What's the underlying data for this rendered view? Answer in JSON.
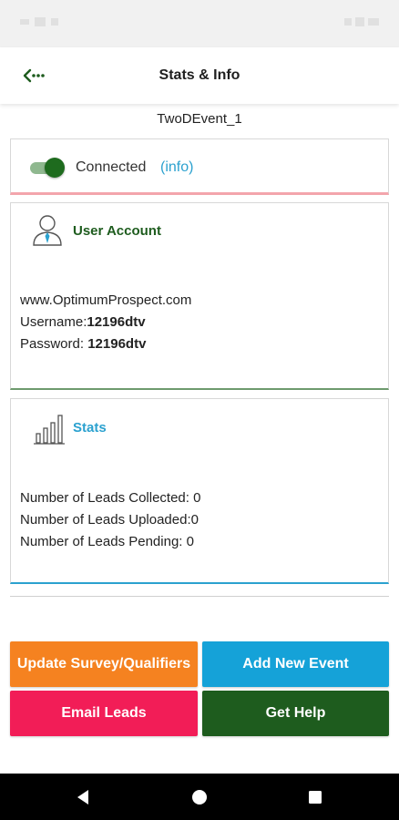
{
  "colors": {
    "accent_green": "#1e5c1e",
    "accent_blue": "#2ba1cf",
    "orange": "#f58220",
    "blue_button": "#15a2d8",
    "pink": "#f21d57",
    "divider_pink": "#f3a5ac"
  },
  "app_bar": {
    "title": "Stats & Info",
    "back_icon": "back-arrow-icon"
  },
  "event_name": "TwoDEvent_1",
  "connection": {
    "toggle_on": true,
    "status_label": "Connected",
    "info_label": "(info)"
  },
  "user_account": {
    "icon": "user-account-icon",
    "heading": "User Account",
    "website": "www.OptimumProspect.com",
    "username_label": "Username:",
    "username_value": "12196dtv",
    "password_label": "Password: ",
    "password_value": "12196dtv"
  },
  "stats": {
    "icon": "bar-chart-icon",
    "heading": "Stats",
    "leads_collected_label": "Number of Leads Collected: ",
    "leads_collected_value": "0",
    "leads_uploaded_label": "Number of Leads Uploaded:",
    "leads_uploaded_value": "0",
    "leads_pending_label": "Number of Leads Pending: ",
    "leads_pending_value": "0"
  },
  "buttons": {
    "update_survey": "Update Survey/Qualifiers",
    "add_event": "Add New Event",
    "email_leads": "Email Leads",
    "get_help": "Get Help"
  },
  "nav_bar": {
    "back_icon": "nav-back-icon",
    "home_icon": "nav-home-icon",
    "recents_icon": "nav-recents-icon"
  }
}
